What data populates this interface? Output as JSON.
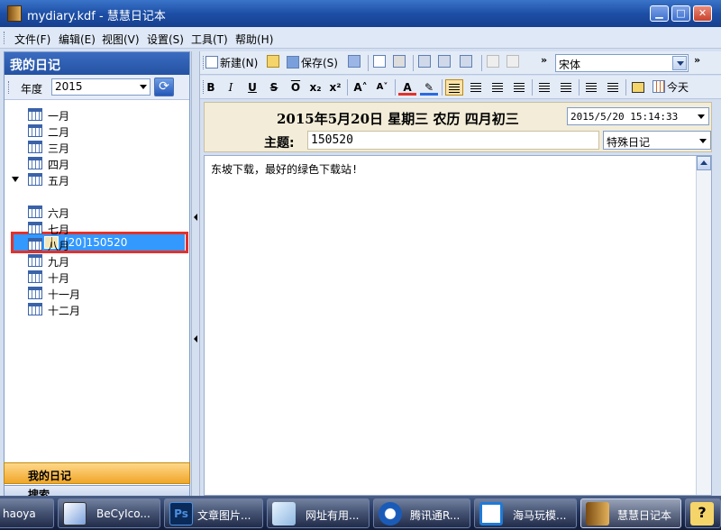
{
  "window": {
    "title": "mydiary.kdf - 慧慧日记本",
    "min_label": "▁",
    "max_label": "□",
    "close_label": "✕"
  },
  "menu": [
    "文件(F)",
    "编辑(E)",
    "视图(V)",
    "设置(S)",
    "工具(T)",
    "帮助(H)"
  ],
  "sidebar": {
    "title": "我的日记",
    "year_label": "年度",
    "year_value": "2015",
    "months": [
      "一月",
      "二月",
      "三月",
      "四月",
      "五月",
      "六月",
      "七月",
      "八月",
      "九月",
      "十月",
      "十一月",
      "十二月"
    ],
    "expanded_month": "五月",
    "selected_entry": "[20]150520",
    "nav_active": "我的日记",
    "nav_second": "搜索"
  },
  "toolbar": {
    "new_label": "新建(N)",
    "save_label": "保存(S)",
    "font_name": "宋体",
    "today_label": "今天",
    "overflow": "»"
  },
  "format": {
    "bold": "B",
    "italic": "I",
    "underline": "U",
    "strike": "S",
    "overline": "O",
    "subscript": "x₂",
    "superscript": "x²",
    "grow": "A˄",
    "shrink": "A˅",
    "font_color": "A"
  },
  "editor": {
    "date_title": "2015年5月20日  星期三   农历 四月初三",
    "datetime": "2015/5/20 15:14:33",
    "subject_label": "主题:",
    "subject": "150520",
    "category": "特殊日记",
    "body": "东坡下载，最好的绿色下载站!"
  },
  "taskbar": [
    {
      "label": "haoya",
      "active": false
    },
    {
      "label": "BeCyIco...",
      "active": false
    },
    {
      "label": "文章图片...",
      "active": false
    },
    {
      "label": "网址有用...",
      "active": false
    },
    {
      "label": "腾讯通R...",
      "active": false
    },
    {
      "label": "海马玩模...",
      "active": false
    },
    {
      "label": "慧慧日记本",
      "active": true
    }
  ],
  "colors": {
    "titlebar": "#1d4fa6",
    "selection": "#3399ff",
    "highlight_box": "#e2322b",
    "nav_active": "#f0a62a"
  }
}
